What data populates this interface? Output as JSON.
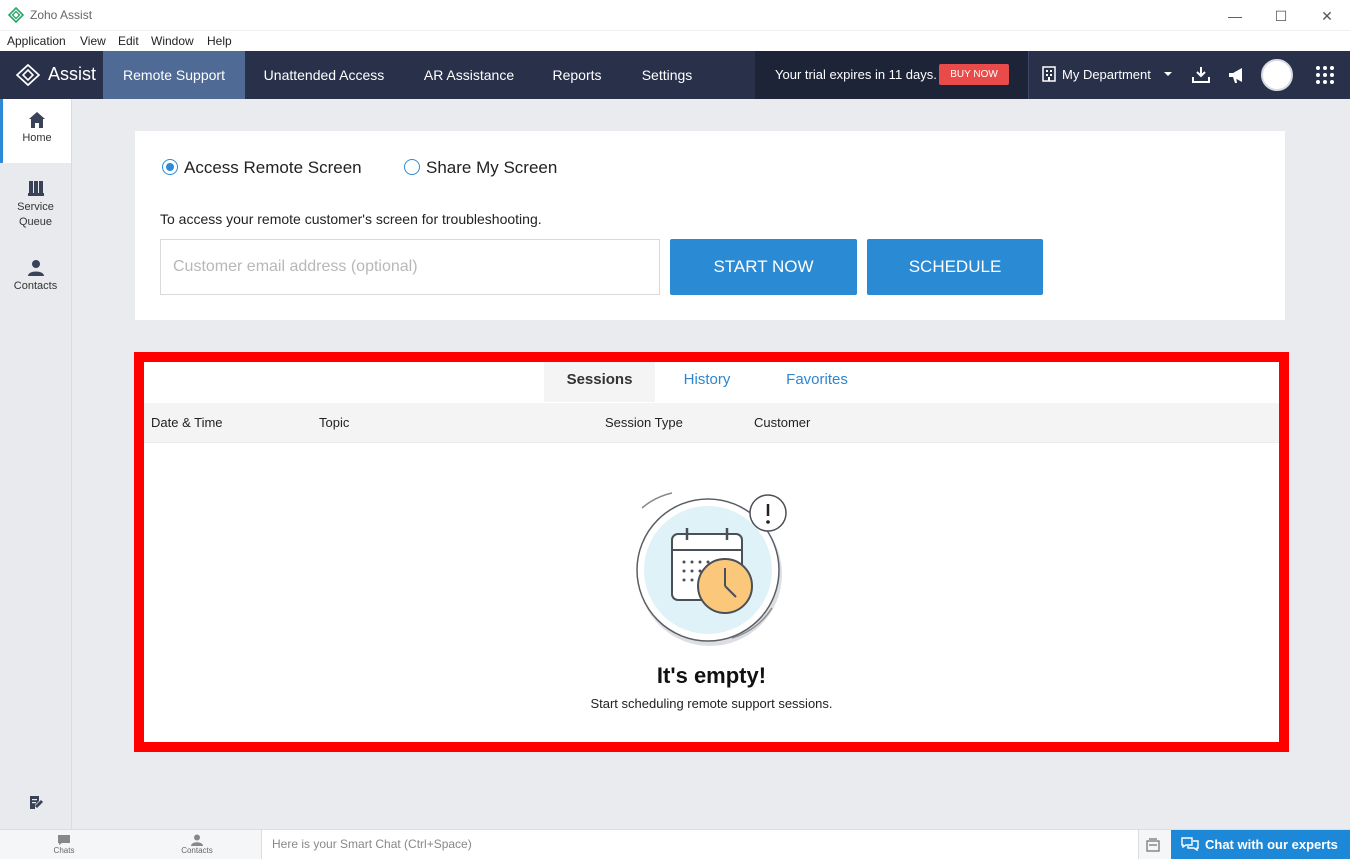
{
  "window": {
    "title": "Zoho Assist",
    "minimize": "—",
    "maximize": "☐",
    "close": "✕"
  },
  "menu": [
    "Application",
    "View",
    "Edit",
    "Window",
    "Help"
  ],
  "navbar": {
    "brand": "Assist",
    "tabs": [
      {
        "label": "Remote Support",
        "active": true
      },
      {
        "label": "Unattended Access",
        "active": false
      },
      {
        "label": "AR Assistance",
        "active": false
      },
      {
        "label": "Reports",
        "active": false
      },
      {
        "label": "Settings",
        "active": false
      }
    ],
    "trial_text": "Your trial expires in 11 days.",
    "buy_now": "BUY NOW",
    "department": "My Department",
    "icons": [
      "download-icon",
      "megaphone-icon",
      "avatar",
      "apps-grid-icon"
    ]
  },
  "sidebar": {
    "items": [
      {
        "label": "Home",
        "icon": "home-icon",
        "active": true
      },
      {
        "label": "Service Queue",
        "icon": "service-queue-icon",
        "active": false
      },
      {
        "label": "Contacts",
        "icon": "contacts-icon",
        "active": false
      }
    ],
    "bottom_icon": "notes-icon"
  },
  "session_card": {
    "options": [
      {
        "label": "Access Remote Screen",
        "checked": true
      },
      {
        "label": "Share My Screen",
        "checked": false
      }
    ],
    "description": "To access your remote customer's screen for troubleshooting.",
    "email_placeholder": "Customer email address (optional)",
    "email_value": "",
    "start_now": "START NOW",
    "schedule": "SCHEDULE"
  },
  "sessions": {
    "tabs": [
      {
        "label": "Sessions",
        "active": true
      },
      {
        "label": "History",
        "active": false
      },
      {
        "label": "Favorites",
        "active": false
      }
    ],
    "columns": [
      "Date & Time",
      "Topic",
      "Session Type",
      "Customer"
    ],
    "empty_title": "It's empty!",
    "empty_subtitle": "Start scheduling remote support sessions."
  },
  "bottombar": {
    "chats": "Chats",
    "contacts": "Contacts",
    "smart_chat_placeholder": "Here is your Smart Chat (Ctrl+Space)",
    "chat_experts": "Chat with our experts"
  },
  "colors": {
    "navbar": "#28304a",
    "active_tab": "#4f6a94",
    "accent": "#2a8ad4",
    "highlight_border": "#ff0000",
    "buy_now": "#e94b4b"
  }
}
